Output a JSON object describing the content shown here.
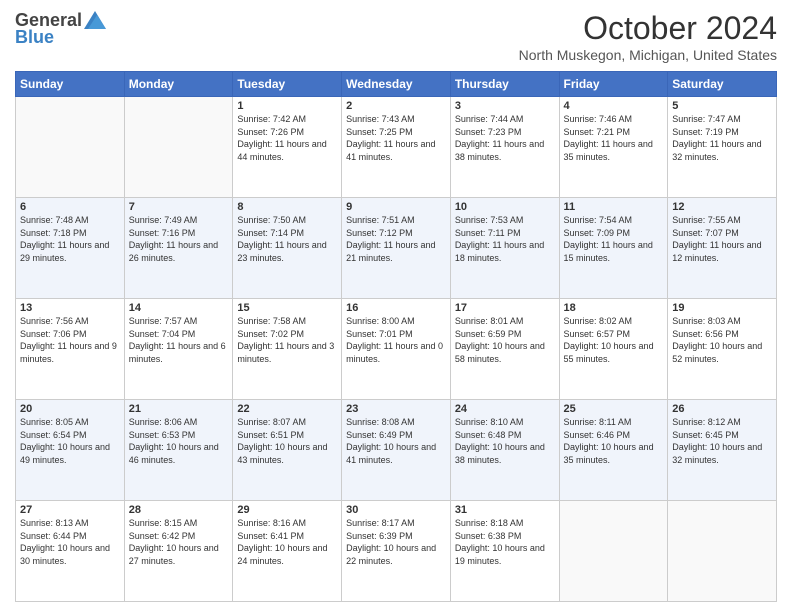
{
  "logo": {
    "general": "General",
    "blue": "Blue"
  },
  "header": {
    "month": "October 2024",
    "location": "North Muskegon, Michigan, United States"
  },
  "weekdays": [
    "Sunday",
    "Monday",
    "Tuesday",
    "Wednesday",
    "Thursday",
    "Friday",
    "Saturday"
  ],
  "weeks": [
    [
      {
        "day": "",
        "sunrise": "",
        "sunset": "",
        "daylight": ""
      },
      {
        "day": "",
        "sunrise": "",
        "sunset": "",
        "daylight": ""
      },
      {
        "day": "1",
        "sunrise": "Sunrise: 7:42 AM",
        "sunset": "Sunset: 7:26 PM",
        "daylight": "Daylight: 11 hours and 44 minutes."
      },
      {
        "day": "2",
        "sunrise": "Sunrise: 7:43 AM",
        "sunset": "Sunset: 7:25 PM",
        "daylight": "Daylight: 11 hours and 41 minutes."
      },
      {
        "day": "3",
        "sunrise": "Sunrise: 7:44 AM",
        "sunset": "Sunset: 7:23 PM",
        "daylight": "Daylight: 11 hours and 38 minutes."
      },
      {
        "day": "4",
        "sunrise": "Sunrise: 7:46 AM",
        "sunset": "Sunset: 7:21 PM",
        "daylight": "Daylight: 11 hours and 35 minutes."
      },
      {
        "day": "5",
        "sunrise": "Sunrise: 7:47 AM",
        "sunset": "Sunset: 7:19 PM",
        "daylight": "Daylight: 11 hours and 32 minutes."
      }
    ],
    [
      {
        "day": "6",
        "sunrise": "Sunrise: 7:48 AM",
        "sunset": "Sunset: 7:18 PM",
        "daylight": "Daylight: 11 hours and 29 minutes."
      },
      {
        "day": "7",
        "sunrise": "Sunrise: 7:49 AM",
        "sunset": "Sunset: 7:16 PM",
        "daylight": "Daylight: 11 hours and 26 minutes."
      },
      {
        "day": "8",
        "sunrise": "Sunrise: 7:50 AM",
        "sunset": "Sunset: 7:14 PM",
        "daylight": "Daylight: 11 hours and 23 minutes."
      },
      {
        "day": "9",
        "sunrise": "Sunrise: 7:51 AM",
        "sunset": "Sunset: 7:12 PM",
        "daylight": "Daylight: 11 hours and 21 minutes."
      },
      {
        "day": "10",
        "sunrise": "Sunrise: 7:53 AM",
        "sunset": "Sunset: 7:11 PM",
        "daylight": "Daylight: 11 hours and 18 minutes."
      },
      {
        "day": "11",
        "sunrise": "Sunrise: 7:54 AM",
        "sunset": "Sunset: 7:09 PM",
        "daylight": "Daylight: 11 hours and 15 minutes."
      },
      {
        "day": "12",
        "sunrise": "Sunrise: 7:55 AM",
        "sunset": "Sunset: 7:07 PM",
        "daylight": "Daylight: 11 hours and 12 minutes."
      }
    ],
    [
      {
        "day": "13",
        "sunrise": "Sunrise: 7:56 AM",
        "sunset": "Sunset: 7:06 PM",
        "daylight": "Daylight: 11 hours and 9 minutes."
      },
      {
        "day": "14",
        "sunrise": "Sunrise: 7:57 AM",
        "sunset": "Sunset: 7:04 PM",
        "daylight": "Daylight: 11 hours and 6 minutes."
      },
      {
        "day": "15",
        "sunrise": "Sunrise: 7:58 AM",
        "sunset": "Sunset: 7:02 PM",
        "daylight": "Daylight: 11 hours and 3 minutes."
      },
      {
        "day": "16",
        "sunrise": "Sunrise: 8:00 AM",
        "sunset": "Sunset: 7:01 PM",
        "daylight": "Daylight: 11 hours and 0 minutes."
      },
      {
        "day": "17",
        "sunrise": "Sunrise: 8:01 AM",
        "sunset": "Sunset: 6:59 PM",
        "daylight": "Daylight: 10 hours and 58 minutes."
      },
      {
        "day": "18",
        "sunrise": "Sunrise: 8:02 AM",
        "sunset": "Sunset: 6:57 PM",
        "daylight": "Daylight: 10 hours and 55 minutes."
      },
      {
        "day": "19",
        "sunrise": "Sunrise: 8:03 AM",
        "sunset": "Sunset: 6:56 PM",
        "daylight": "Daylight: 10 hours and 52 minutes."
      }
    ],
    [
      {
        "day": "20",
        "sunrise": "Sunrise: 8:05 AM",
        "sunset": "Sunset: 6:54 PM",
        "daylight": "Daylight: 10 hours and 49 minutes."
      },
      {
        "day": "21",
        "sunrise": "Sunrise: 8:06 AM",
        "sunset": "Sunset: 6:53 PM",
        "daylight": "Daylight: 10 hours and 46 minutes."
      },
      {
        "day": "22",
        "sunrise": "Sunrise: 8:07 AM",
        "sunset": "Sunset: 6:51 PM",
        "daylight": "Daylight: 10 hours and 43 minutes."
      },
      {
        "day": "23",
        "sunrise": "Sunrise: 8:08 AM",
        "sunset": "Sunset: 6:49 PM",
        "daylight": "Daylight: 10 hours and 41 minutes."
      },
      {
        "day": "24",
        "sunrise": "Sunrise: 8:10 AM",
        "sunset": "Sunset: 6:48 PM",
        "daylight": "Daylight: 10 hours and 38 minutes."
      },
      {
        "day": "25",
        "sunrise": "Sunrise: 8:11 AM",
        "sunset": "Sunset: 6:46 PM",
        "daylight": "Daylight: 10 hours and 35 minutes."
      },
      {
        "day": "26",
        "sunrise": "Sunrise: 8:12 AM",
        "sunset": "Sunset: 6:45 PM",
        "daylight": "Daylight: 10 hours and 32 minutes."
      }
    ],
    [
      {
        "day": "27",
        "sunrise": "Sunrise: 8:13 AM",
        "sunset": "Sunset: 6:44 PM",
        "daylight": "Daylight: 10 hours and 30 minutes."
      },
      {
        "day": "28",
        "sunrise": "Sunrise: 8:15 AM",
        "sunset": "Sunset: 6:42 PM",
        "daylight": "Daylight: 10 hours and 27 minutes."
      },
      {
        "day": "29",
        "sunrise": "Sunrise: 8:16 AM",
        "sunset": "Sunset: 6:41 PM",
        "daylight": "Daylight: 10 hours and 24 minutes."
      },
      {
        "day": "30",
        "sunrise": "Sunrise: 8:17 AM",
        "sunset": "Sunset: 6:39 PM",
        "daylight": "Daylight: 10 hours and 22 minutes."
      },
      {
        "day": "31",
        "sunrise": "Sunrise: 8:18 AM",
        "sunset": "Sunset: 6:38 PM",
        "daylight": "Daylight: 10 hours and 19 minutes."
      },
      {
        "day": "",
        "sunrise": "",
        "sunset": "",
        "daylight": ""
      },
      {
        "day": "",
        "sunrise": "",
        "sunset": "",
        "daylight": ""
      }
    ]
  ]
}
